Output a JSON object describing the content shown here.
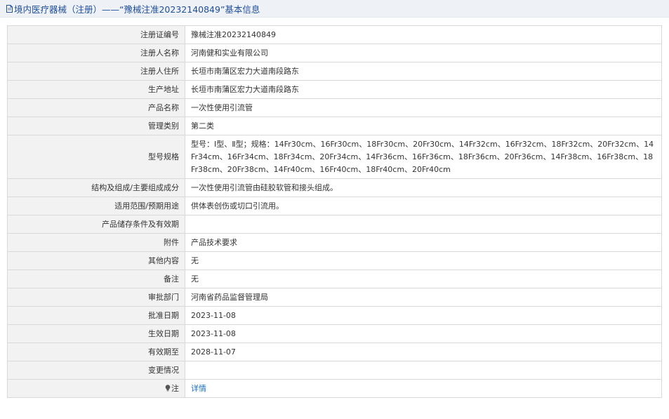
{
  "header": {
    "title": "境内医疗器械（注册）——“豫械注准20232140849”基本信息"
  },
  "rows": [
    {
      "label": "注册证编号",
      "value": "豫械注准20232140849"
    },
    {
      "label": "注册人名称",
      "value": "河南健和实业有限公司"
    },
    {
      "label": "注册人住所",
      "value": "长垣市南蒲区宏力大道南段路东"
    },
    {
      "label": "生产地址",
      "value": "长垣市南蒲区宏力大道南段路东"
    },
    {
      "label": "产品名称",
      "value": "一次性使用引流管"
    },
    {
      "label": "管理类别",
      "value": "第二类"
    },
    {
      "label": "型号规格",
      "value": "型号：Ⅰ型、Ⅱ型；规格：14Fr30cm、16Fr30cm、18Fr30cm、20Fr30cm、14Fr32cm、16Fr32cm、18Fr32cm、20Fr32cm、14Fr34cm、16Fr34cm、18Fr34cm、20Fr34cm、14Fr36cm、16Fr36cm、18Fr36cm、20Fr36cm、14Fr38cm、16Fr38cm、18Fr38cm、20Fr38cm、14Fr40cm、16Fr40cm、18Fr40cm、20Fr40cm"
    },
    {
      "label": "结构及组成/主要组成成分",
      "value": "一次性使用引流管由硅胶软管和接头组成。"
    },
    {
      "label": "适用范围/预期用途",
      "value": "供体表创伤或切口引流用。"
    },
    {
      "label": "产品储存条件及有效期",
      "value": ""
    },
    {
      "label": "附件",
      "value": "产品技术要求"
    },
    {
      "label": "其他内容",
      "value": "无"
    },
    {
      "label": "备注",
      "value": "无"
    },
    {
      "label": "审批部门",
      "value": "河南省药品监督管理局"
    },
    {
      "label": "批准日期",
      "value": "2023-11-08"
    },
    {
      "label": "生效日期",
      "value": "2023-11-08"
    },
    {
      "label": "有效期至",
      "value": "2028-11-07"
    },
    {
      "label": "变更情况",
      "value": ""
    }
  ],
  "note": {
    "label": "注",
    "icon": "lightbulb-icon",
    "link_text": "详情"
  },
  "colors": {
    "title": "#1f4e9b",
    "label_bg": "#f2f2f2",
    "border": "#d9d9d9",
    "link": "#1a6fc4"
  }
}
